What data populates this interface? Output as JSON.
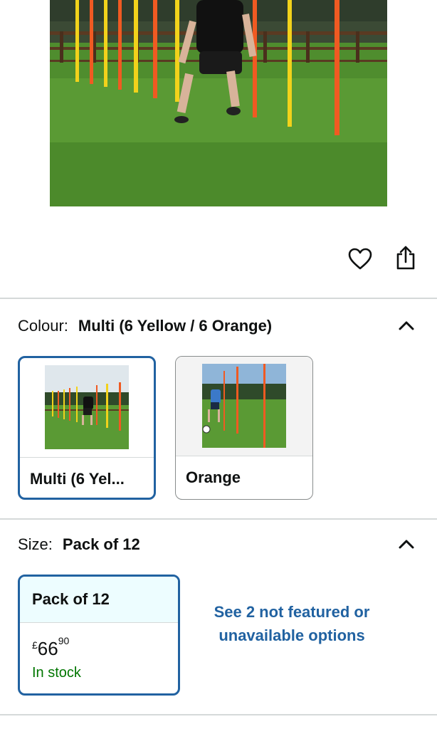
{
  "product": {
    "hero_alt": "Player dribbling through yellow and orange slalom poles"
  },
  "actions": {
    "wishlist_icon": "heart-icon",
    "share_icon": "share-icon"
  },
  "colour": {
    "label": "Colour:",
    "selected": "Multi (6 Yellow / 6 Orange)",
    "options": [
      {
        "name": "Multi (6 Yel...",
        "selected": true
      },
      {
        "name": "Orange",
        "selected": false
      }
    ]
  },
  "size": {
    "label": "Size:",
    "selected": "Pack of 12",
    "options": [
      {
        "name": "Pack of 12",
        "currency": "£",
        "price_whole": "66",
        "price_fraction": "90",
        "stock": "In stock",
        "selected": true
      }
    ],
    "see_more": "See 2 not featured or unavailable options"
  },
  "colors": {
    "link": "#2162a1",
    "in_stock": "#007600",
    "selected_border": "#2162a1"
  }
}
